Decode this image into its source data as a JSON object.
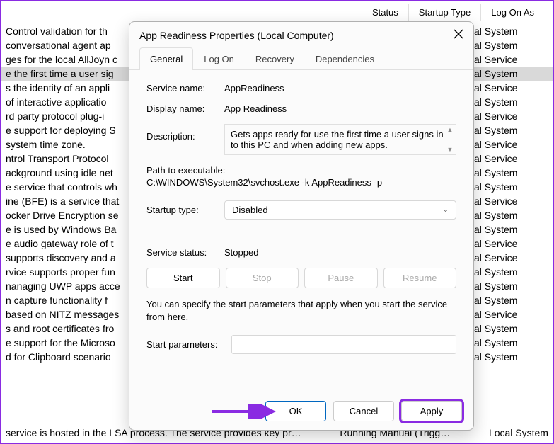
{
  "bgHeader": {
    "status": "Status",
    "startupType": "Startup Type",
    "logOnAs": "Log On As"
  },
  "bgRows": [
    {
      "desc": "Control validation for th",
      "logon": "al System"
    },
    {
      "desc": " conversational agent ap",
      "logon": "al System"
    },
    {
      "desc": "ges for the local AllJoyn c",
      "logon": "al Service"
    },
    {
      "desc": "e the first time a user sig",
      "logon": "al System",
      "selected": true
    },
    {
      "desc": "s the identity of an appli",
      "logon": "al Service"
    },
    {
      "desc": " of interactive applicatio",
      "logon": "al System"
    },
    {
      "desc": "rd party protocol plug-i",
      "logon": "al Service"
    },
    {
      "desc": "e support for deploying S",
      "logon": "al System"
    },
    {
      "desc": " system time zone.",
      "logon": "al Service"
    },
    {
      "desc": "ntrol Transport Protocol",
      "logon": "al Service"
    },
    {
      "desc": "ackground using idle net",
      "logon": "al System"
    },
    {
      "desc": "e service that controls wh",
      "logon": "al System"
    },
    {
      "desc": "ine (BFE) is a service that",
      "logon": "al Service"
    },
    {
      "desc": "ocker Drive Encryption se",
      "logon": "al System"
    },
    {
      "desc": "e is used by Windows Ba",
      "logon": "al System"
    },
    {
      "desc": "e audio gateway role of t",
      "logon": "al Service"
    },
    {
      "desc": " supports discovery and a",
      "logon": "al Service"
    },
    {
      "desc": "rvice supports proper fun",
      "logon": "al System"
    },
    {
      "desc": "nanaging UWP apps acce",
      "logon": "al System"
    },
    {
      "desc": "n capture functionality f",
      "logon": "al System"
    },
    {
      "desc": "based on NITZ messages",
      "logon": "al Service"
    },
    {
      "desc": "s and root certificates fro",
      "logon": "al System"
    },
    {
      "desc": "e support for the Microso",
      "logon": "al System"
    },
    {
      "desc": "d for Clipboard scenario",
      "logon": "al System"
    }
  ],
  "bgBottom": {
    "left": " service is hosted in the LSA process. The service provides key pr…",
    "mid": "Running        Manual (Trigg…",
    "right": "Local System"
  },
  "dialog": {
    "title": "App Readiness Properties (Local Computer)",
    "tabs": {
      "general": "General",
      "logOn": "Log On",
      "recovery": "Recovery",
      "dependencies": "Dependencies"
    },
    "labels": {
      "serviceName": "Service name:",
      "displayName": "Display name:",
      "description": "Description:",
      "pathLabel": "Path to executable:",
      "startupType": "Startup type:",
      "serviceStatus": "Service status:",
      "startParams": "Start parameters:"
    },
    "values": {
      "serviceName": "AppReadiness",
      "displayName": "App Readiness",
      "description": "Gets apps ready for use the first time a user signs in to this PC and when adding new apps.",
      "path": "C:\\WINDOWS\\System32\\svchost.exe -k AppReadiness -p",
      "startupType": "Disabled",
      "serviceStatus": "Stopped",
      "startParams": ""
    },
    "buttons": {
      "start": "Start",
      "stop": "Stop",
      "pause": "Pause",
      "resume": "Resume"
    },
    "hint": "You can specify the start parameters that apply when you start the service from here.",
    "footer": {
      "ok": "OK",
      "cancel": "Cancel",
      "apply": "Apply"
    }
  }
}
